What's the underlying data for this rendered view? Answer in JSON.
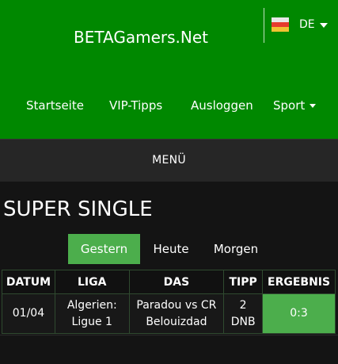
{
  "header": {
    "brand": "BETAGamers.Net",
    "language": {
      "code": "DE",
      "icon": "flag-icon"
    },
    "nav": [
      {
        "label": "Startseite"
      },
      {
        "label": "VIP-Tipps"
      },
      {
        "label": "Ausloggen"
      },
      {
        "label": "Sport",
        "icon": "caret-down-icon"
      }
    ]
  },
  "menu": {
    "label": "MENÜ"
  },
  "main": {
    "title": "SUPER SINGLE",
    "tabs": [
      {
        "label": "Gestern",
        "active": true
      },
      {
        "label": "Heute",
        "active": false
      },
      {
        "label": "Morgen",
        "active": false
      }
    ],
    "table": {
      "columns": [
        "DATUM",
        "LIGA",
        "DAS",
        "TIPP",
        "ERGEBNIS"
      ],
      "rows": [
        {
          "datum": "01/04",
          "liga_line1": "Algerien:",
          "liga_line2": "Ligue 1",
          "das_line1": "Paradou vs CR",
          "das_line2": "Belouizdad",
          "tipp_line1": "2",
          "tipp_line2": "DNB",
          "ergebnis": "0:3"
        }
      ]
    }
  },
  "colors": {
    "header_bg": "#008800",
    "menu_bg": "#262626",
    "page_bg": "#141414",
    "accent_green": "#4cae4c"
  }
}
